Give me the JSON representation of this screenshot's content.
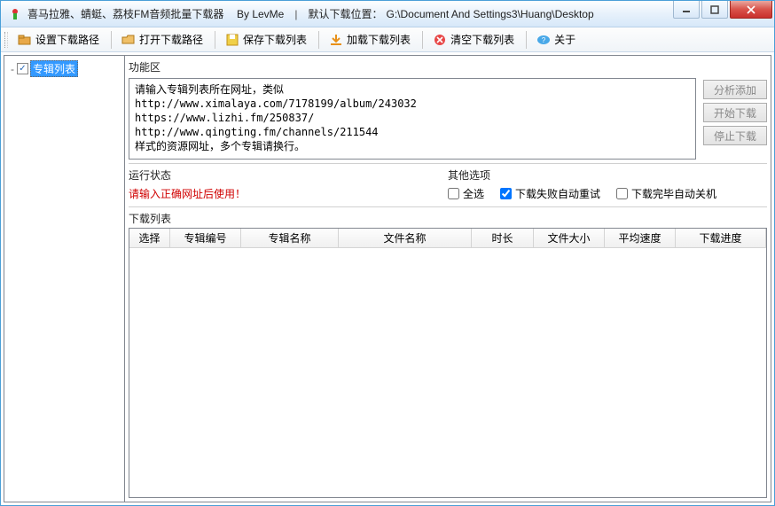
{
  "titlebar": {
    "app_name": "喜马拉雅、蜻蜓、荔枝FM音频批量下载器",
    "author": "By LevMe",
    "separator": "|",
    "default_path_label": "默认下载位置：",
    "default_path": "G:\\Document And Settings3\\Huang\\Desktop"
  },
  "toolbar": {
    "set_path": "设置下载路径",
    "open_path": "打开下载路径",
    "save_list": "保存下载列表",
    "load_list": "加载下载列表",
    "clear_list": "清空下载列表",
    "about": "关于"
  },
  "sidebar": {
    "root_label": "专辑列表"
  },
  "func": {
    "title": "功能区",
    "url_text": "请输入专辑列表所在网址，类似\nhttp://www.ximalaya.com/7178199/album/243032\nhttps://www.lizhi.fm/250837/\nhttp://www.qingting.fm/channels/211544\n样式的资源网址，多个专辑请换行。",
    "analyze": "分析添加",
    "start": "开始下载",
    "stop": "停止下载"
  },
  "status": {
    "title": "运行状态",
    "message": "请输入正确网址后使用！"
  },
  "options": {
    "title": "其他选项",
    "select_all": "全选",
    "retry": "下载失败自动重试",
    "shutdown": "下载完毕自动关机",
    "select_all_checked": false,
    "retry_checked": true,
    "shutdown_checked": false
  },
  "list": {
    "title": "下载列表",
    "columns": {
      "select": "选择",
      "album_no": "专辑编号",
      "album_name": "专辑名称",
      "file_name": "文件名称",
      "duration": "时长",
      "file_size": "文件大小",
      "avg_speed": "平均速度",
      "progress": "下载进度"
    },
    "rows": []
  }
}
